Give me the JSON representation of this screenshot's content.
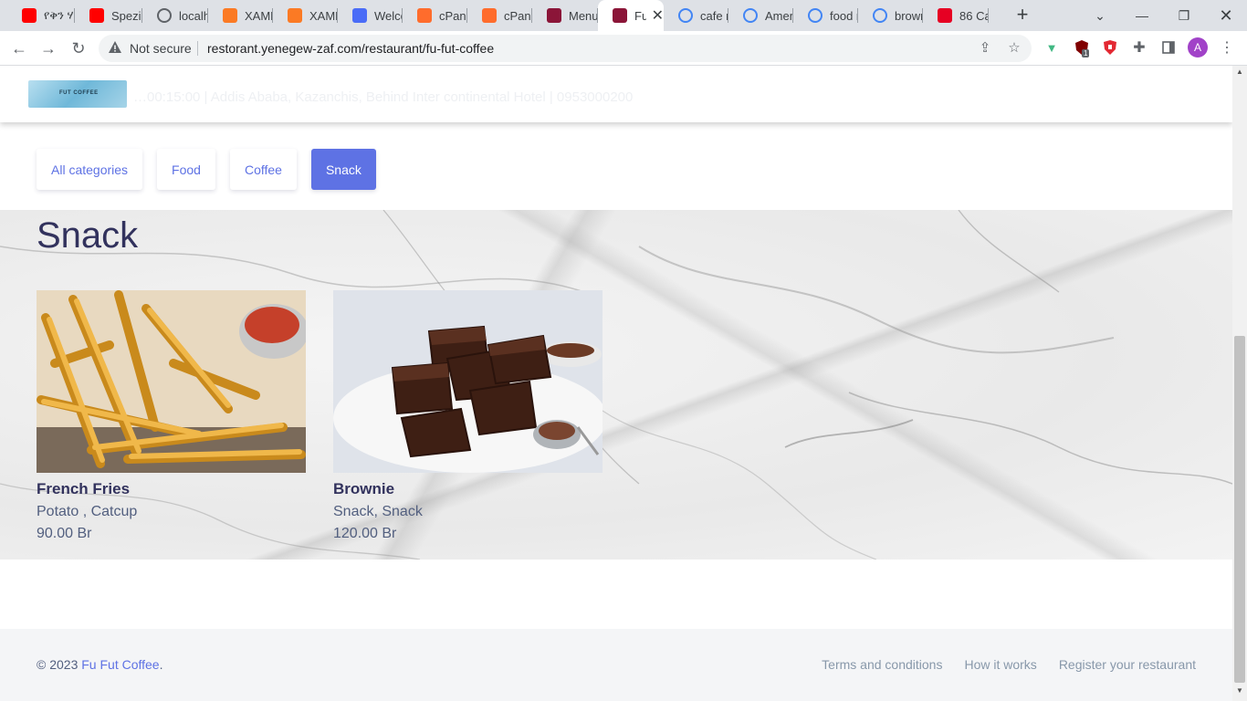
{
  "browser": {
    "tabs": [
      {
        "title": "የቅን ሃ",
        "icon": "youtube-icon",
        "color": "#ff0000"
      },
      {
        "title": "Spezia",
        "icon": "youtube-icon",
        "color": "#ff0000"
      },
      {
        "title": "localh",
        "icon": "globe-icon",
        "color": "#5f6368"
      },
      {
        "title": "XAMP",
        "icon": "xampp-icon",
        "color": "#fb7a24"
      },
      {
        "title": "XAMP",
        "icon": "xampp-icon",
        "color": "#fb7a24"
      },
      {
        "title": "Welco",
        "icon": "cloud-icon",
        "color": "#4a6cf7"
      },
      {
        "title": "cPanel",
        "icon": "cpanel-icon",
        "color": "#ff6c2c"
      },
      {
        "title": "cPanel",
        "icon": "cpanel-icon",
        "color": "#ff6c2c"
      },
      {
        "title": "Menu",
        "icon": "restaurant-icon",
        "color": "#8b1538"
      },
      {
        "title": "Fu",
        "icon": "restaurant-icon",
        "color": "#8b1538"
      },
      {
        "title": "cafe n",
        "icon": "google-icon",
        "color": "#4285f4"
      },
      {
        "title": "Ameri",
        "icon": "google-icon",
        "color": "#4285f4"
      },
      {
        "title": "food r",
        "icon": "google-icon",
        "color": "#4285f4"
      },
      {
        "title": "brown",
        "icon": "google-icon",
        "color": "#4285f4"
      },
      {
        "title": "86 Ca",
        "icon": "pinterest-icon",
        "color": "#e60023"
      }
    ],
    "security_label": "Not secure",
    "url": "restorant.yenegew-zaf.com/restaurant/fu-fut-coffee",
    "avatar_letter": "A",
    "extension_badge": "1"
  },
  "header": {
    "logo_text": "FUT COFFEE",
    "info": "…00:15:00  |  Addis Ababa, Kazanchis, Behind Inter continental Hotel  |  0953000200"
  },
  "categories": [
    {
      "label": "All categories",
      "active": false
    },
    {
      "label": "Food",
      "active": false
    },
    {
      "label": "Coffee",
      "active": false
    },
    {
      "label": "Snack",
      "active": true
    }
  ],
  "section": {
    "title": "Snack",
    "items": [
      {
        "name": "French Fries",
        "description": "Potato , Catcup",
        "price": "90.00 Br",
        "image": "french-fries-photo"
      },
      {
        "name": "Brownie",
        "description": "Snack, Snack",
        "price": "120.00 Br",
        "image": "brownie-photo"
      }
    ]
  },
  "footer": {
    "copyright_prefix": "© 2023",
    "brand": "Fu Fut Coffee",
    "copyright_suffix": ".",
    "links": [
      "Terms and conditions",
      "How it works",
      "Register your restaurant"
    ]
  },
  "colors": {
    "primary": "#5e72e4",
    "heading": "#32325d",
    "text": "#525f7f",
    "footer_bg": "#f4f5f7"
  }
}
